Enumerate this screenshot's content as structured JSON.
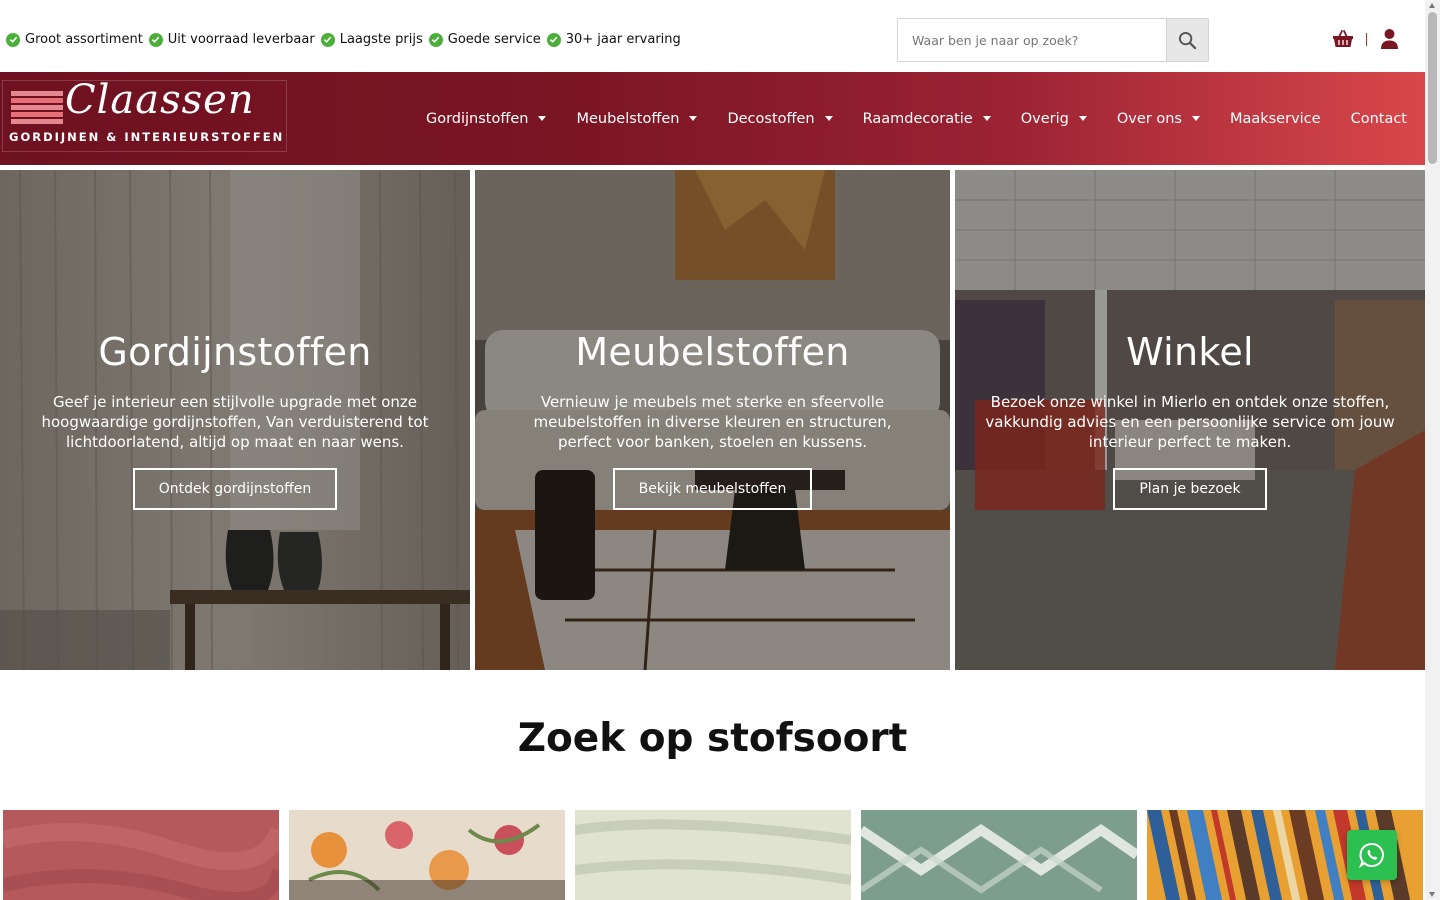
{
  "topbar": {
    "usps": [
      "Groot assortiment",
      "Uit voorraad leverbaar",
      "Laagste prijs",
      "Goede service",
      "30+ jaar ervaring"
    ],
    "search_placeholder": "Waar ben je naar op zoek?",
    "icons": {
      "usp": "check-circle-icon",
      "search": "search-icon",
      "cart": "basket-icon",
      "account": "user-icon"
    }
  },
  "header": {
    "logo": {
      "script": "Claassen",
      "sub": "GORDIJNEN & INTERIEURSTOFFEN"
    },
    "nav": [
      {
        "label": "Gordijnstoffen",
        "dropdown": true
      },
      {
        "label": "Meubelstoffen",
        "dropdown": true
      },
      {
        "label": "Decostoffen",
        "dropdown": true
      },
      {
        "label": "Raamdecoratie",
        "dropdown": true
      },
      {
        "label": "Overig",
        "dropdown": true
      },
      {
        "label": "Over ons",
        "dropdown": true
      },
      {
        "label": "Maakservice",
        "dropdown": false
      },
      {
        "label": "Contact",
        "dropdown": false
      }
    ]
  },
  "hero": [
    {
      "title": "Gordijnstoffen",
      "text": "Geef je interieur een stijlvolle upgrade met onze hoogwaardige gordijnstoffen, Van verduisterend tot lichtdoorlatend, altijd op maat en naar wens.",
      "button": "Ontdek gordijnstoffen"
    },
    {
      "title": "Meubelstoffen",
      "text": "Vernieuw je meubels met sterke en sfeervolle meubelstoffen in diverse kleuren en structuren, perfect voor banken, stoelen en kussens.",
      "button": "Bekijk meubelstoffen"
    },
    {
      "title": "Winkel",
      "text": "Bezoek onze winkel in Mierlo en ontdek onze stoffen, vakkundig advies en een persoonlijke service om jouw interieur perfect te maken.",
      "button": "Plan je bezoek"
    }
  ],
  "section": {
    "title": "Zoek op stofsoort"
  },
  "floating": {
    "whatsapp_icon": "whatsapp-icon"
  },
  "colors": {
    "brand_dark": "#6e1120",
    "brand_light": "#d9474b",
    "check_green": "#4cae3a",
    "whatsapp_green": "#2bc04f",
    "icon_red": "#7a1524"
  }
}
